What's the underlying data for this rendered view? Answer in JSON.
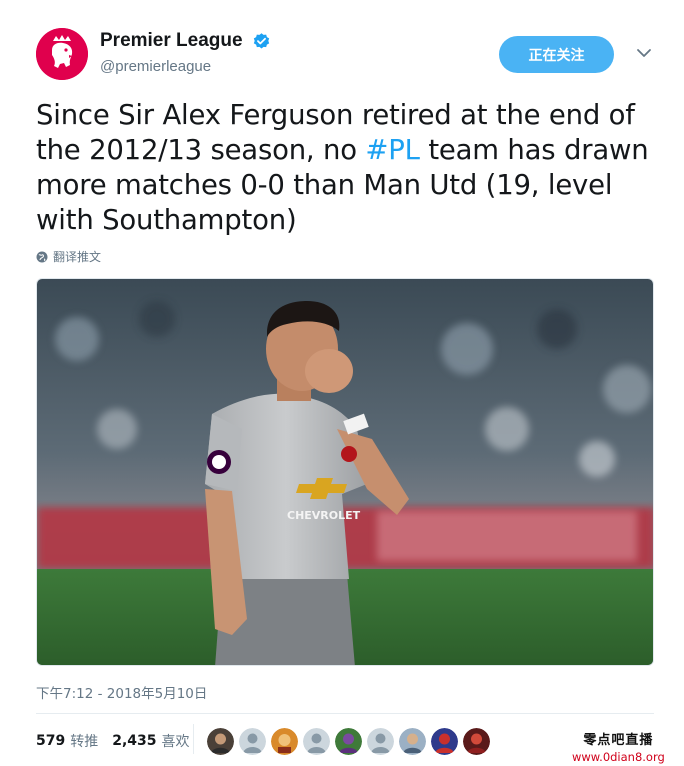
{
  "header": {
    "display_name": "Premier League",
    "handle": "@premierleague",
    "follow_label": "正在关注",
    "verified": true
  },
  "tweet": {
    "text_before": "Since Sir Alex Ferguson retired at the end of the 2012/13 season, no ",
    "hashtag": "#PL",
    "text_after": " team has drawn more matches 0-0 than Man Utd (19, level with Southampton)",
    "translate_label": "翻译推文"
  },
  "media": {
    "shirt_sponsor": "CHEVROLET"
  },
  "timestamp": "下午7:12 - 2018年5月10日",
  "stats": {
    "retweets_count": "579",
    "retweets_label": "转推",
    "likes_count": "2,435",
    "likes_label": "喜欢"
  },
  "likers": [
    "liker-1",
    "liker-2",
    "liker-3",
    "liker-4",
    "liker-5",
    "liker-6",
    "liker-7",
    "liker-8",
    "liker-9"
  ],
  "watermark": {
    "text": "零点吧直播",
    "url": "www.0dian8.org"
  },
  "colors": {
    "accent": "#1da1f2",
    "follow_button": "#4ab3f4",
    "brand": "#e0004d"
  },
  "icons": {
    "verified": "verified-badge-icon",
    "caret": "chevron-down-icon",
    "translate": "globe-icon"
  }
}
